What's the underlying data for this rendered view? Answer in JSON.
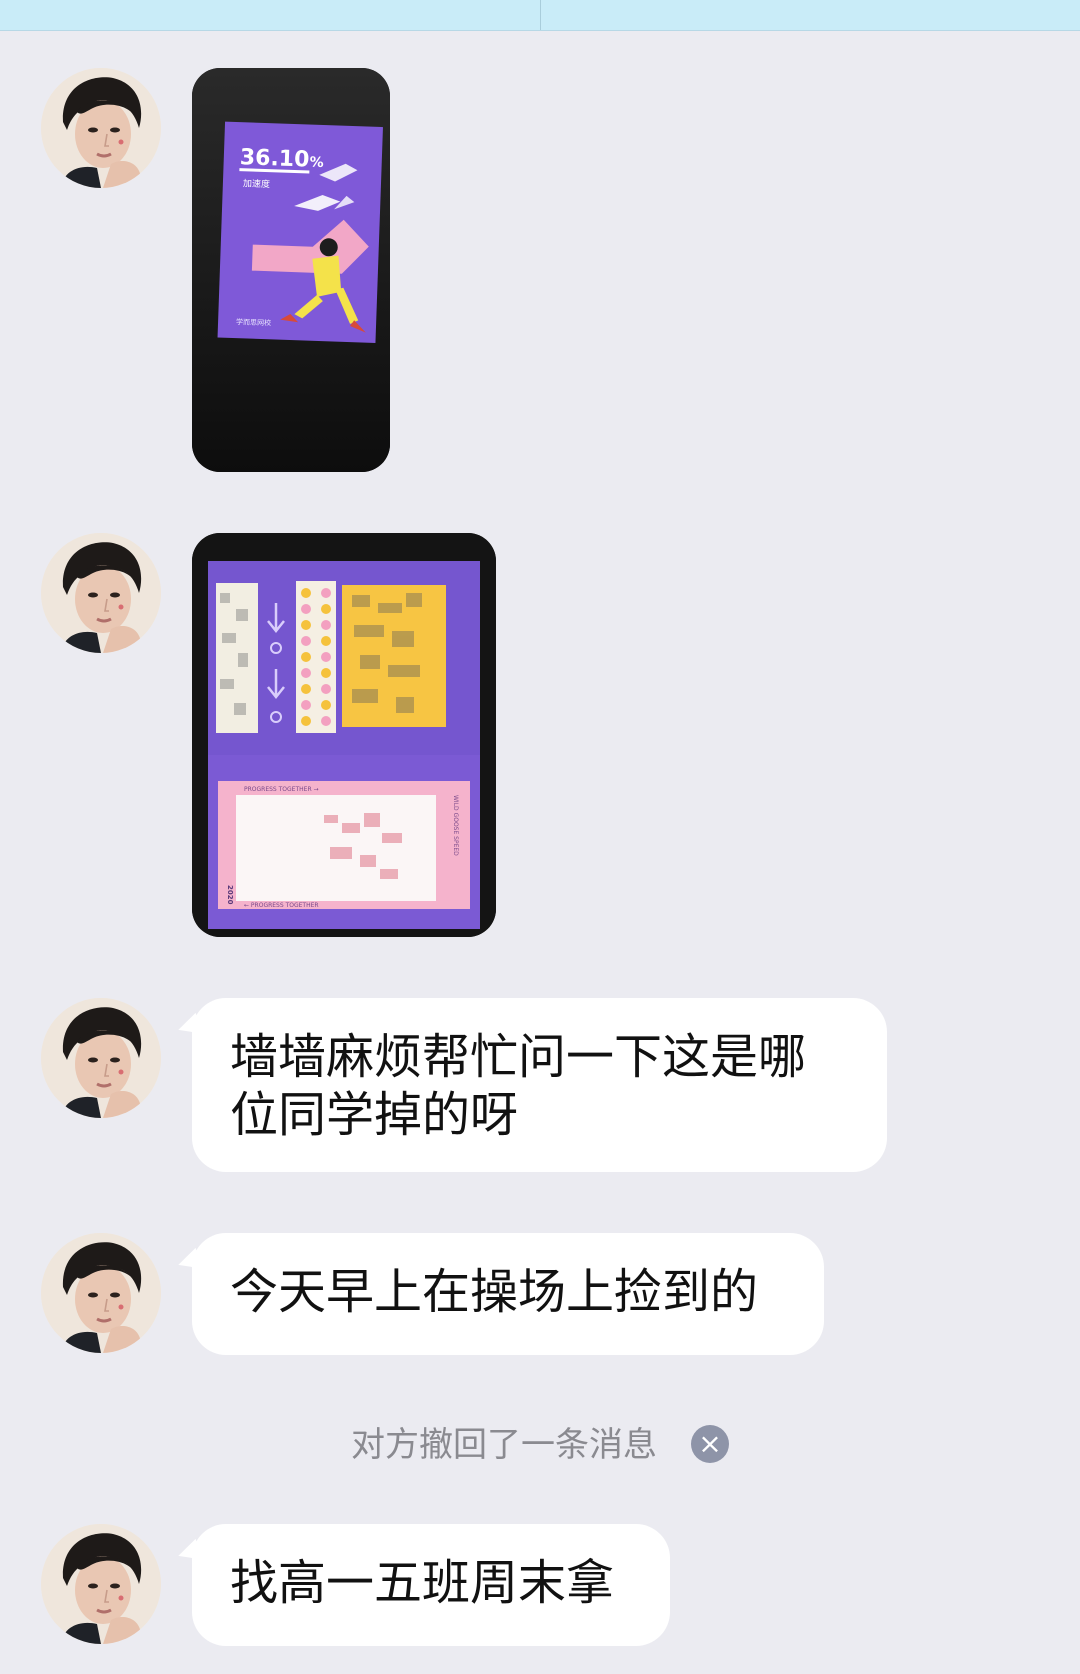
{
  "messages": [
    {
      "type": "image",
      "avatar": "avatar"
    },
    {
      "type": "image",
      "avatar": "avatar"
    },
    {
      "type": "text",
      "text": "墙墙麻烦帮忙问一下这是哪位同学掉的呀"
    },
    {
      "type": "text",
      "text": "今天早上在操场上捡到的"
    },
    {
      "type": "text",
      "text": "找高一五班周末拿"
    }
  ],
  "image1": {
    "title_number": "36.10",
    "title_suffix": "%",
    "subtitle": "加速度",
    "footer": "学而思网校"
  },
  "image2": {
    "banner_top": "PROGRESS TOGETHER →",
    "banner_bottom": "← PROGRESS TOGETHER",
    "side_text": "WILD GOOSE SPEED",
    "year": "2020"
  },
  "system_notice": {
    "text": "对方撤回了一条消息",
    "close_icon": "×"
  },
  "colors": {
    "background": "#ebebf1",
    "bubble": "#ffffff",
    "purple": "#7b55d6",
    "yellow": "#f6c445",
    "pink": "#f1a4c4"
  }
}
